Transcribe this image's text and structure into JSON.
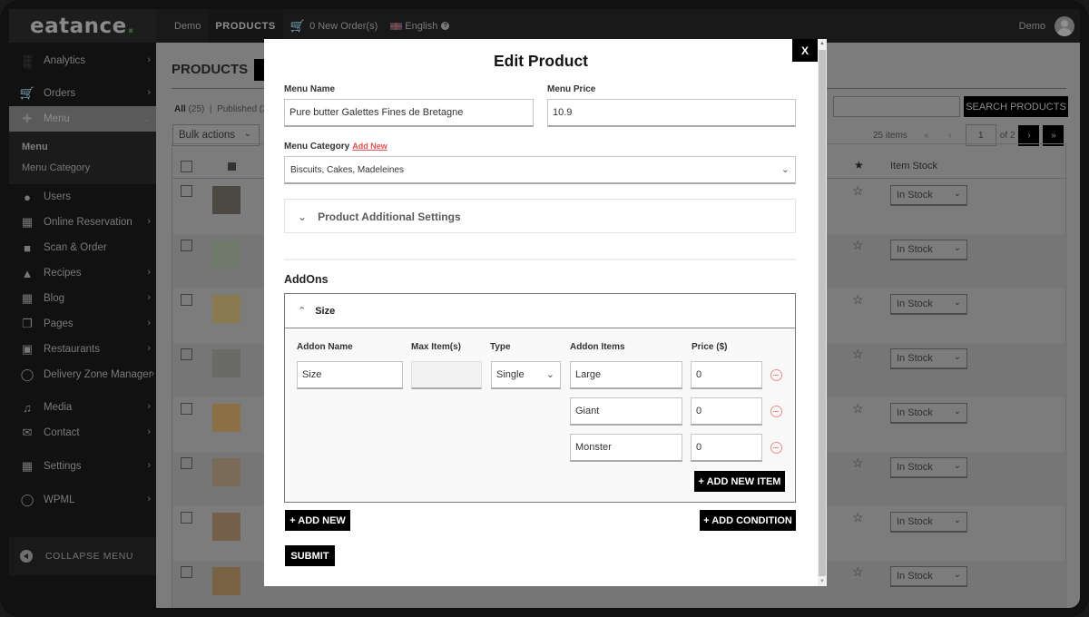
{
  "topbar": {
    "logo": "eatance",
    "items": [
      "Demo",
      "PRODUCTS"
    ],
    "orders": "0 New Order(s)",
    "language": "English",
    "user": "Demo"
  },
  "sidebar": {
    "items": [
      {
        "label": "Analytics",
        "icon": "bar-chart-icon",
        "chevron": true
      },
      {
        "label": "Orders",
        "icon": "cart-icon",
        "chevron": true
      },
      {
        "label": "Menu",
        "icon": "cutlery-icon",
        "chevron": true,
        "active": true
      },
      {
        "label": "Users",
        "icon": "user-icon",
        "chevron": false
      },
      {
        "label": "Online Reservation",
        "icon": "calendar-icon",
        "chevron": true
      },
      {
        "label": "Scan & Order",
        "icon": "cup-icon",
        "chevron": false
      },
      {
        "label": "Recipes",
        "icon": "cake-icon",
        "chevron": true
      },
      {
        "label": "Blog",
        "icon": "newspaper-icon",
        "chevron": true
      },
      {
        "label": "Pages",
        "icon": "pages-icon",
        "chevron": true
      },
      {
        "label": "Restaurants",
        "icon": "store-icon",
        "chevron": true
      },
      {
        "label": "Delivery Zone Manager",
        "icon": "globe-icon",
        "chevron": true
      },
      {
        "label": "Media",
        "icon": "media-icon",
        "chevron": true
      },
      {
        "label": "Contact",
        "icon": "envelope-icon",
        "chevron": true
      },
      {
        "label": "Settings",
        "icon": "sliders-icon",
        "chevron": true
      },
      {
        "label": "WPML",
        "icon": "wpml-icon",
        "chevron": true
      }
    ],
    "submenu": [
      "Menu",
      "Menu Category"
    ],
    "collapse": "COLLAPSE MENU"
  },
  "page": {
    "title": "PRODUCTS",
    "filter_all": "All",
    "filter_all_count": "(25)",
    "filter_published": "Published (2",
    "bulk_actions": "Bulk actions",
    "search_button": "SEARCH PRODUCTS",
    "items_count": "25 items",
    "current_page": "1",
    "total_pages": "of 2",
    "col_stock": "Item Stock",
    "rows": [
      {
        "stock": "In Stock"
      },
      {
        "stock": "In Stock"
      },
      {
        "stock": "In Stock"
      },
      {
        "stock": "In Stock"
      },
      {
        "stock": "In Stock"
      },
      {
        "stock": "In Stock"
      },
      {
        "stock": "In Stock"
      },
      {
        "stock": "In Stock"
      }
    ]
  },
  "modal": {
    "title": "Edit Product",
    "close": "X",
    "menu_name_label": "Menu Name",
    "menu_name": "Pure butter Galettes Fines de Bretagne",
    "menu_price_label": "Menu Price",
    "menu_price": "10.9",
    "category_label": "Menu Category",
    "category_add": "Add New",
    "category": "Biscuits, Cakes, Madeleines",
    "additional_settings": "Product Additional Settings",
    "addons_heading": "AddOns",
    "addon_group": {
      "title": "Size",
      "col_name": "Addon Name",
      "col_max": "Max Item(s)",
      "col_type": "Type",
      "col_items": "Addon Items",
      "col_price": "Price ($)",
      "name": "Size",
      "max": "",
      "type": "Single",
      "items": [
        {
          "name": "Large",
          "price": "0"
        },
        {
          "name": "Giant",
          "price": "0"
        },
        {
          "name": "Monster",
          "price": "0"
        }
      ],
      "add_item": "+ ADD NEW ITEM"
    },
    "add_new": "+ ADD NEW",
    "add_condition": "+ ADD CONDITION",
    "submit": "SUBMIT"
  }
}
